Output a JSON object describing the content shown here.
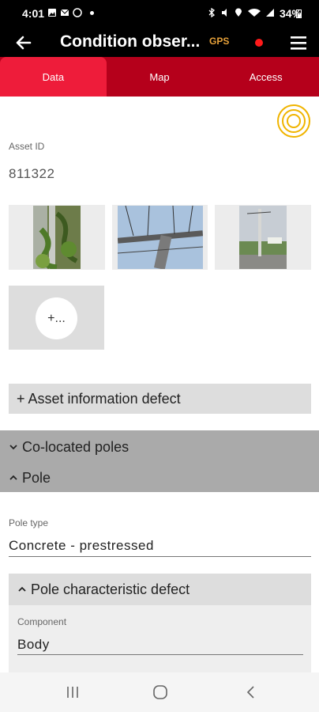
{
  "status_bar": {
    "time": "4:01",
    "battery": "34%",
    "icons_left": [
      "gallery-icon",
      "mail-icon",
      "whatsapp-icon",
      "dot-icon"
    ],
    "icons_right": [
      "bluetooth-icon",
      "mute-icon",
      "location-icon",
      "wifi-icon",
      "signal-icon",
      "battery-icon"
    ]
  },
  "app_bar": {
    "title": "Condition obser...",
    "gps_label": "GPS",
    "record_color": "#ff1a1a"
  },
  "tabs": [
    {
      "label": "Data",
      "active": true
    },
    {
      "label": "Map",
      "active": false
    },
    {
      "label": "Access",
      "active": false
    }
  ],
  "asset": {
    "id_label": "Asset ID",
    "id_value": "811322"
  },
  "photos": {
    "add_label": "+..."
  },
  "buttons": {
    "asset_info_defect": "+ Asset information defect"
  },
  "sections": {
    "co_located": "Co-located poles",
    "pole": "Pole"
  },
  "pole": {
    "type_label": "Pole type",
    "type_value": "Concrete - prestressed"
  },
  "characteristic": {
    "header": "Pole characteristic defect",
    "component_label": "Component",
    "component_value": "Body"
  },
  "colors": {
    "brand_red": "#ee1c3a",
    "brand_dark_red": "#b5001b",
    "gps_orange": "#e8a23a",
    "target_yellow": "#f0b400"
  }
}
